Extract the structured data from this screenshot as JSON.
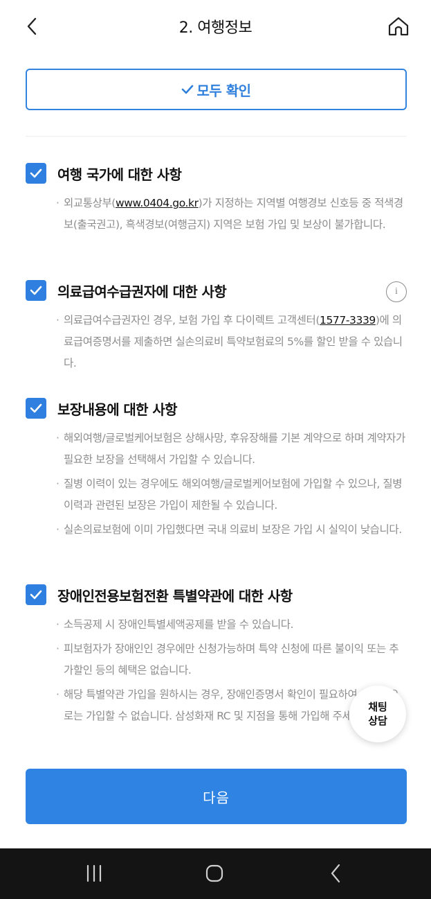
{
  "header": {
    "title": "2. 여행정보",
    "back_icon": "chevron-left-icon",
    "home_icon": "home-icon"
  },
  "confirm_all": {
    "label": "모두 확인",
    "icon": "check-icon"
  },
  "sections": [
    {
      "title": "여행 국가에 대한 사항",
      "checked": true,
      "bullets": [
        {
          "pre": "외교통상부(",
          "link": "www.0404.go.kr",
          "post": ")가 지정하는 지역별 여행경보 신호등 중 적색경보(출국권고), 흑색경보(여행금지) 지역은 보험 가입 및 보상이 불가합니다."
        }
      ]
    },
    {
      "title": "의료급여수급권자에 대한 사항",
      "checked": true,
      "has_info": true,
      "info_glyph": "i",
      "bullets": [
        {
          "pre": "의료급여수급권자인 경우, 보험 가입 후 다이렉트 고객센터(",
          "link": "1577-3339",
          "post": ")에 의료급여증명서를 제출하면 실손의료비 특약보험료의 5%를 할인 받을 수 있습니다."
        }
      ]
    },
    {
      "title": "보장내용에 대한 사항",
      "checked": true,
      "bullets": [
        {
          "pre": "해외여행/글로벌케어보험은 상해사망, 후유장해를 기본 계약으로 하며 계약자가 필요한 보장을 선택해서 가입할 수 있습니다."
        },
        {
          "pre": "질병 이력이 있는 경우에도 해외여행/글로벌케어보험에 가입할 수 있으나, 질병 이력과 관련된 보장은 가입이 제한될 수 있습니다."
        },
        {
          "pre": "실손의료보험에 이미 가입했다면 국내 의료비 보장은 가입 시 실익이 낮습니다."
        }
      ]
    },
    {
      "title": "장애인전용보험전환 특별약관에 대한 사항",
      "checked": true,
      "bullets": [
        {
          "pre": "소득공제 시 장애인특별세액공제를 받을 수 있습니다."
        },
        {
          "pre": "피보험자가 장애인인 경우에만 신청가능하며 특약 신청에 따른 불이익 또는 추가할인 등의 혜택은 없습니다."
        },
        {
          "pre": "해당 특별약관 가입을 원하시는 경우, 장애인증명서 확인이 필요하여 인터넷으로는 가입할 수 없습니다. 삼성화재 RC 및 지점을 통해 가입해 주세요."
        }
      ]
    }
  ],
  "bullet_mark": "·",
  "next_button": {
    "label": "다음"
  },
  "chat_button": {
    "line1": "채팅",
    "line2": "상담"
  },
  "system_nav": {
    "recents_icon": "recents-icon",
    "home_icon": "circle-home-icon",
    "back_icon": "back-icon"
  },
  "colors": {
    "accent": "#2f84e3",
    "text": "#111111",
    "muted": "#8c8c8c",
    "navbar": "#141414"
  }
}
